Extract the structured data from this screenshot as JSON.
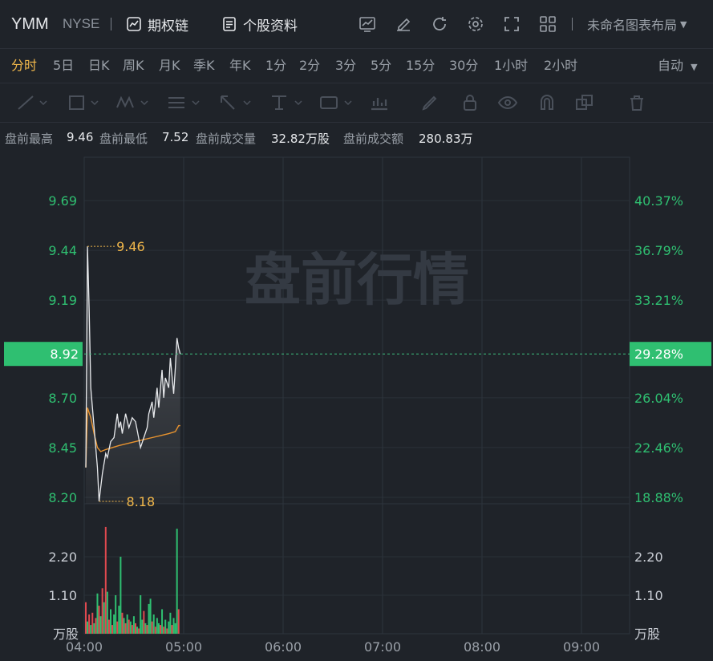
{
  "header": {
    "ticker": "YMM",
    "exchange": "NYSE",
    "options_chain_label": "期权链",
    "stock_profile_label": "个股资料",
    "layout_label": "未命名图表布局"
  },
  "periods": [
    {
      "label": "分时",
      "active": true
    },
    {
      "label": "5日"
    },
    {
      "label": "日K"
    },
    {
      "label": "周K"
    },
    {
      "label": "月K"
    },
    {
      "label": "季K"
    },
    {
      "label": "年K"
    },
    {
      "label": "1分"
    },
    {
      "label": "2分"
    },
    {
      "label": "3分"
    },
    {
      "label": "5分"
    },
    {
      "label": "15分"
    },
    {
      "label": "30分"
    },
    {
      "label": "1小时"
    },
    {
      "label": "2小时"
    }
  ],
  "auto_label": "自动",
  "premarket_stats": {
    "high_label": "盘前最高",
    "high_value": "9.46",
    "low_label": "盘前最低",
    "low_value": "7.52",
    "volume_label": "盘前成交量",
    "volume_value": "32.82万股",
    "turnover_label": "盘前成交额",
    "turnover_value": "280.83万"
  },
  "chart_data": {
    "type": "line",
    "watermark": "盘前行情",
    "price_axis": {
      "ticks": [
        "9.69",
        "9.44",
        "9.19",
        "8.92",
        "8.70",
        "8.45",
        "8.20"
      ],
      "values": [
        9.69,
        9.44,
        9.19,
        8.92,
        8.7,
        8.45,
        8.2
      ],
      "current": "8.92"
    },
    "pct_axis": {
      "ticks": [
        "40.37%",
        "36.79%",
        "33.21%",
        "29.28%",
        "26.04%",
        "22.46%",
        "18.88%"
      ],
      "current": "29.28%"
    },
    "x_ticks": [
      "04:00",
      "05:00",
      "06:00",
      "07:00",
      "08:00",
      "09:00"
    ],
    "high_label": "9.46",
    "low_label": "8.18",
    "volume_axis": {
      "ticks": [
        "2.20",
        "1.10"
      ],
      "unit": "万股"
    },
    "price_series": [
      {
        "t": 0,
        "v": 8.35
      },
      {
        "t": 1,
        "v": 9.46
      },
      {
        "t": 2,
        "v": 9.15
      },
      {
        "t": 3,
        "v": 8.75
      },
      {
        "t": 5,
        "v": 8.55
      },
      {
        "t": 7,
        "v": 8.35
      },
      {
        "t": 8,
        "v": 8.18
      },
      {
        "t": 9,
        "v": 8.25
      },
      {
        "t": 10,
        "v": 8.32
      },
      {
        "t": 12,
        "v": 8.42
      },
      {
        "t": 13,
        "v": 8.4
      },
      {
        "t": 15,
        "v": 8.48
      },
      {
        "t": 17,
        "v": 8.5
      },
      {
        "t": 19,
        "v": 8.62
      },
      {
        "t": 20,
        "v": 8.55
      },
      {
        "t": 21,
        "v": 8.58
      },
      {
        "t": 22,
        "v": 8.52
      },
      {
        "t": 24,
        "v": 8.62
      },
      {
        "t": 26,
        "v": 8.55
      },
      {
        "t": 28,
        "v": 8.6
      },
      {
        "t": 30,
        "v": 8.58
      },
      {
        "t": 33,
        "v": 8.45
      },
      {
        "t": 35,
        "v": 8.5
      },
      {
        "t": 37,
        "v": 8.55
      },
      {
        "t": 38,
        "v": 8.62
      },
      {
        "t": 40,
        "v": 8.68
      },
      {
        "t": 41,
        "v": 8.6
      },
      {
        "t": 43,
        "v": 8.75
      },
      {
        "t": 44,
        "v": 8.65
      },
      {
        "t": 46,
        "v": 8.84
      },
      {
        "t": 47,
        "v": 8.7
      },
      {
        "t": 48,
        "v": 8.8
      },
      {
        "t": 50,
        "v": 8.75
      },
      {
        "t": 51,
        "v": 8.9
      },
      {
        "t": 53,
        "v": 8.72
      },
      {
        "t": 54,
        "v": 8.85
      },
      {
        "t": 55,
        "v": 9.0
      },
      {
        "t": 56,
        "v": 8.95
      },
      {
        "t": 57,
        "v": 8.92
      }
    ],
    "avg_series": [
      {
        "t": 0,
        "v": 8.35
      },
      {
        "t": 1,
        "v": 8.65
      },
      {
        "t": 3,
        "v": 8.6
      },
      {
        "t": 5,
        "v": 8.52
      },
      {
        "t": 7,
        "v": 8.45
      },
      {
        "t": 9,
        "v": 8.43
      },
      {
        "t": 12,
        "v": 8.44
      },
      {
        "t": 16,
        "v": 8.45
      },
      {
        "t": 20,
        "v": 8.46
      },
      {
        "t": 25,
        "v": 8.47
      },
      {
        "t": 30,
        "v": 8.48
      },
      {
        "t": 35,
        "v": 8.49
      },
      {
        "t": 40,
        "v": 8.5
      },
      {
        "t": 45,
        "v": 8.51
      },
      {
        "t": 50,
        "v": 8.52
      },
      {
        "t": 54,
        "v": 8.53
      },
      {
        "t": 56,
        "v": 8.56
      },
      {
        "t": 57,
        "v": 8.56
      }
    ],
    "volume_bars": [
      {
        "t": 0,
        "v": 0.9,
        "up": false
      },
      {
        "t": 1,
        "v": 0.35,
        "up": true
      },
      {
        "t": 2,
        "v": 0.55,
        "up": false
      },
      {
        "t": 3,
        "v": 0.25,
        "up": true
      },
      {
        "t": 4,
        "v": 0.6,
        "up": false
      },
      {
        "t": 5,
        "v": 0.3,
        "up": true
      },
      {
        "t": 6,
        "v": 0.45,
        "up": false
      },
      {
        "t": 7,
        "v": 1.15,
        "up": true
      },
      {
        "t": 8,
        "v": 0.8,
        "up": false
      },
      {
        "t": 9,
        "v": 0.5,
        "up": true
      },
      {
        "t": 10,
        "v": 1.3,
        "up": false
      },
      {
        "t": 11,
        "v": 0.9,
        "up": true
      },
      {
        "t": 12,
        "v": 3.05,
        "up": false
      },
      {
        "t": 13,
        "v": 1.2,
        "up": true
      },
      {
        "t": 14,
        "v": 0.4,
        "up": false
      },
      {
        "t": 15,
        "v": 0.7,
        "up": true
      },
      {
        "t": 16,
        "v": 0.25,
        "up": false
      },
      {
        "t": 17,
        "v": 0.55,
        "up": true
      },
      {
        "t": 18,
        "v": 1.1,
        "up": true
      },
      {
        "t": 19,
        "v": 0.35,
        "up": false
      },
      {
        "t": 20,
        "v": 0.8,
        "up": true
      },
      {
        "t": 21,
        "v": 2.2,
        "up": true
      },
      {
        "t": 22,
        "v": 0.6,
        "up": false
      },
      {
        "t": 23,
        "v": 0.45,
        "up": true
      },
      {
        "t": 24,
        "v": 0.3,
        "up": false
      },
      {
        "t": 25,
        "v": 0.55,
        "up": true
      },
      {
        "t": 26,
        "v": 0.4,
        "up": false
      },
      {
        "t": 27,
        "v": 0.35,
        "up": true
      },
      {
        "t": 28,
        "v": 0.25,
        "up": false
      },
      {
        "t": 29,
        "v": 0.5,
        "up": true
      },
      {
        "t": 30,
        "v": 0.3,
        "up": false
      },
      {
        "t": 31,
        "v": 0.2,
        "up": true
      },
      {
        "t": 32,
        "v": 0.15,
        "up": false
      },
      {
        "t": 33,
        "v": 1.1,
        "up": true
      },
      {
        "t": 34,
        "v": 0.4,
        "up": true
      },
      {
        "t": 35,
        "v": 0.65,
        "up": false
      },
      {
        "t": 36,
        "v": 0.3,
        "up": true
      },
      {
        "t": 37,
        "v": 0.25,
        "up": false
      },
      {
        "t": 38,
        "v": 0.85,
        "up": true
      },
      {
        "t": 39,
        "v": 1.0,
        "up": true
      },
      {
        "t": 40,
        "v": 0.35,
        "up": false
      },
      {
        "t": 41,
        "v": 0.55,
        "up": true
      },
      {
        "t": 42,
        "v": 0.2,
        "up": false
      },
      {
        "t": 43,
        "v": 0.45,
        "up": true
      },
      {
        "t": 44,
        "v": 0.3,
        "up": true
      },
      {
        "t": 45,
        "v": 0.25,
        "up": false
      },
      {
        "t": 46,
        "v": 0.7,
        "up": true
      },
      {
        "t": 47,
        "v": 0.2,
        "up": false
      },
      {
        "t": 48,
        "v": 0.4,
        "up": true
      },
      {
        "t": 49,
        "v": 0.15,
        "up": false
      },
      {
        "t": 50,
        "v": 0.35,
        "up": true
      },
      {
        "t": 51,
        "v": 0.6,
        "up": true
      },
      {
        "t": 52,
        "v": 0.25,
        "up": false
      },
      {
        "t": 53,
        "v": 0.45,
        "up": true
      },
      {
        "t": 54,
        "v": 0.3,
        "up": true
      },
      {
        "t": 55,
        "v": 3.0,
        "up": true
      },
      {
        "t": 56,
        "v": 0.7,
        "up": false
      }
    ]
  },
  "colors": {
    "background": "#1f2329",
    "up": "#2fbf71",
    "down": "#e0494f",
    "price_line": "#e8eaed",
    "avg_line": "#e8932f",
    "accent": "#f2b84b",
    "current_badge": "#2fbf71"
  },
  "icons": {
    "options_chain": "chart-box-icon",
    "stock_profile": "document-icon",
    "tools": [
      "indicator-icon",
      "edit-icon",
      "refresh-icon",
      "settings-icon",
      "fullscreen-icon",
      "grid-layout-icon"
    ]
  }
}
